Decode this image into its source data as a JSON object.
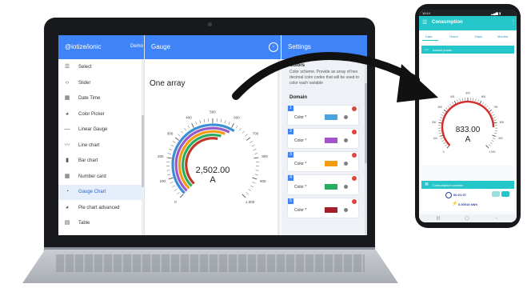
{
  "laptop": {
    "app_brand": "@iotize/ionic",
    "demo_label": "Demo",
    "nav_items": [
      {
        "icon": "list-icon",
        "glyph": "☰",
        "label": "Select"
      },
      {
        "icon": "code-icon",
        "glyph": "‹›",
        "label": "Slider"
      },
      {
        "icon": "calendar-icon",
        "glyph": "▦",
        "label": "Date Time"
      },
      {
        "icon": "palette-icon",
        "glyph": "◕",
        "label": "Color Picker"
      },
      {
        "icon": "linear-gauge-icon",
        "glyph": "—",
        "label": "Linear Gauge"
      },
      {
        "icon": "line-chart-icon",
        "glyph": "〰",
        "label": "Line chart"
      },
      {
        "icon": "bar-chart-icon",
        "glyph": "▮",
        "label": "Bar chart"
      },
      {
        "icon": "grid-icon",
        "glyph": "▦",
        "label": "Number card"
      },
      {
        "icon": "gauge-icon",
        "glyph": "◔",
        "label": "Gauge Chart"
      },
      {
        "icon": "pie-chart-icon",
        "glyph": "◕",
        "label": "Pie chart advanced"
      },
      {
        "icon": "table-icon",
        "glyph": "▤",
        "label": "Table"
      }
    ],
    "active_nav": 8,
    "gauge_panel": {
      "title": "Gauge",
      "subtitle": "One array",
      "value": "2,502.00",
      "unit": "A",
      "ticks": [
        "0",
        "100",
        "200",
        "300",
        "400",
        "500",
        "600",
        "700",
        "800",
        "900",
        "1,000"
      ],
      "min": 0,
      "max": 1000,
      "reading": 2502,
      "arc_colors": [
        "#3b8fd6",
        "#9b59c9",
        "#f39c12",
        "#27ae60",
        "#c0392b"
      ]
    },
    "settings_panel": {
      "title": "Settings",
      "colors_label": "Colors",
      "colors_desc": "Color scheme. Provide an array of hex decimal color codes that will be used to color each variable",
      "domain_label": "Domain",
      "color_field_label": "Color *",
      "color_items": [
        {
          "num": "1",
          "color": "#4aa3df"
        },
        {
          "num": "2",
          "color": "#a352c8"
        },
        {
          "num": "3",
          "color": "#f39c12"
        },
        {
          "num": "4",
          "color": "#27ae60"
        },
        {
          "num": "5",
          "color": "#a31f2a"
        }
      ]
    }
  },
  "phone": {
    "status_time": "10:14",
    "status_icons": "▂▄▆ ▮",
    "app_title": "Consumption",
    "tabs": [
      "Data",
      "Hours",
      "Days",
      "Months"
    ],
    "instant_power_label": "Instant power",
    "gauge_value": "833.00",
    "gauge_unit": "A",
    "gauge_reading": 833,
    "gauge_min": 0,
    "gauge_max": 1000,
    "gauge_ticks": [
      "0",
      "100",
      "200",
      "300",
      "400",
      "500",
      "600",
      "700",
      "800",
      "900",
      "1,000"
    ],
    "counter_label": "Consumption counter",
    "counter_time": "00:01:07",
    "counter_energy": "0.00015 kWh",
    "nav_glyphs": [
      "|||",
      "◯",
      "‹"
    ],
    "accent_color": "#24c6c9",
    "gauge_color": "#d32f2f"
  }
}
